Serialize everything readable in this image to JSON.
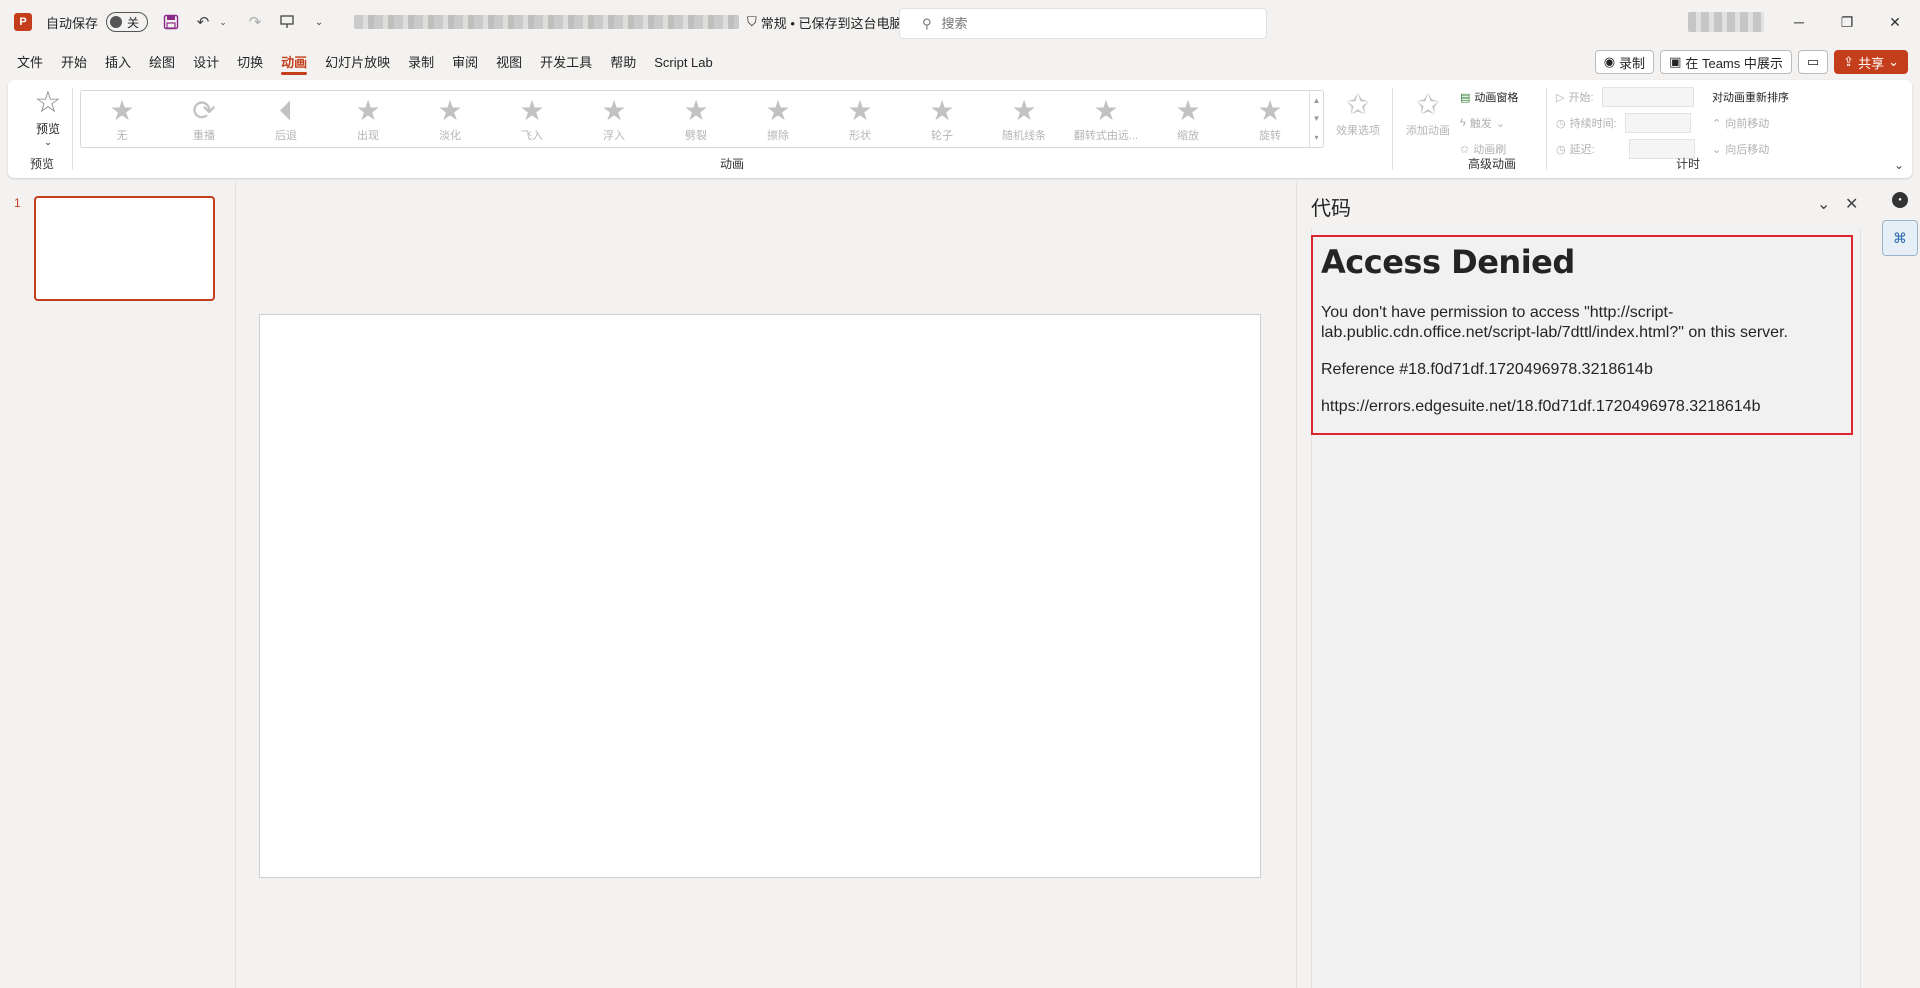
{
  "titlebar": {
    "autosave_label": "自动保存",
    "autosave_state": "关",
    "doc_status": "常规 • 已保存到这台电脑",
    "doc_status_chevron": "⌄",
    "search_placeholder": "搜索",
    "icons": [
      "powerpoint-app-icon",
      "save-icon",
      "undo-icon",
      "redo-icon",
      "present-icon",
      "customize-icon",
      "shield-icon",
      "search-icon"
    ]
  },
  "menu": {
    "items": [
      "文件",
      "开始",
      "插入",
      "绘图",
      "设计",
      "切换",
      "动画",
      "幻灯片放映",
      "录制",
      "审阅",
      "视图",
      "开发工具",
      "帮助",
      "Script Lab"
    ],
    "active_index": 6
  },
  "top_buttons": {
    "record": "录制",
    "teams": "在 Teams 中展示",
    "share": "共享"
  },
  "ribbon": {
    "preview_label": "预览",
    "preview_group": "预览",
    "animations": [
      "无",
      "重播",
      "后退",
      "出现",
      "淡化",
      "飞入",
      "浮入",
      "劈裂",
      "擦除",
      "形状",
      "轮子",
      "随机线条",
      "翻转式由远...",
      "缩放",
      "旋转"
    ],
    "effect_options": "效果选项",
    "animation_group": "动画",
    "add_animation": "添加动画",
    "animation_pane": "动画窗格",
    "trigger": "触发",
    "animation_painter": "动画刷",
    "advanced_group": "高级动画",
    "start_label": "开始:",
    "duration_label": "持续时间:",
    "delay_label": "延迟:",
    "reorder_title": "对动画重新排序",
    "move_earlier": "向前移动",
    "move_later": "向后移动",
    "timing_group": "计时"
  },
  "thumbs": {
    "slide_number": "1"
  },
  "taskpane": {
    "title": "代码",
    "heading": "Access Denied",
    "message": "You don't have permission to access \"http://script-lab.public.cdn.office.net/script-lab/7dttl/index.html?\" on this server.",
    "reference": "Reference #18.f0d71df.1720496978.3218614b",
    "error_url": "https://errors.edgesuite.net/18.f0d71df.1720496978.3218614b"
  },
  "colors": {
    "accent": "#c43e1c",
    "error_border": "#d9262f"
  }
}
